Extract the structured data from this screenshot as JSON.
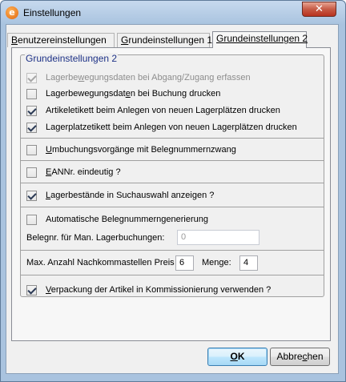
{
  "window": {
    "title": "Einstellungen",
    "close_glyph": "✕",
    "icon_letter": "e"
  },
  "tabs": [
    {
      "label_u": "B",
      "label_rest": "enutzereinstellungen",
      "active": false
    },
    {
      "label_u": "G",
      "label_rest": "rundeinstellungen 1",
      "active": false
    },
    {
      "label_u": "",
      "label_rest": "Grundeinstellungen 2",
      "active": true
    }
  ],
  "group": {
    "title": "Grundeinstellungen 2",
    "checkboxes": [
      {
        "pre": "Lagerbe",
        "u": "w",
        "post": "egungsdaten bei Abgang/Zugang erfassen",
        "checked": true,
        "disabled": true
      },
      {
        "pre": "Lagerbewegungsdat",
        "u": "e",
        "post": "n bei Buchung drucken",
        "checked": false,
        "disabled": false
      },
      {
        "pre": "Artikeletikett beim Anlegen von neuen Lagerplätzen drucken",
        "u": "",
        "post": "",
        "checked": true,
        "disabled": false
      },
      {
        "pre": "Lagerplatzetikett beim Anlegen von neuen Lagerplätzen drucken",
        "u": "",
        "post": "",
        "checked": true,
        "disabled": false
      },
      {
        "pre": "",
        "u": "U",
        "post": "mbuchungsvorgänge mit Belegnummernzwang",
        "checked": false,
        "disabled": false
      },
      {
        "pre": "",
        "u": "E",
        "post": "ANNr. eindeutig ?",
        "checked": false,
        "disabled": false
      },
      {
        "pre": "",
        "u": "L",
        "post": "agerbestände in Suchauswahl anzeigen ?",
        "checked": true,
        "disabled": false
      },
      {
        "pre": "Automatische Belegnummerngenerierung",
        "u": "",
        "post": "",
        "checked": false,
        "disabled": false
      }
    ],
    "belegnr_label": "Belegnr. für Man. Lagerbuchungen:",
    "belegnr_value": "0",
    "nachkomma_label": "Max. Anzahl Nachkommastellen Preis",
    "nachkomma_preis_value": "6",
    "menge_label": "Menge:",
    "menge_value": "4",
    "verpackung": {
      "pre": "",
      "u": "V",
      "post": "erpackung der Artikel in Kommissionierung verwenden ?",
      "checked": true,
      "disabled": false
    }
  },
  "buttons": {
    "ok": {
      "u": "O",
      "rest": "K"
    },
    "cancel": {
      "pre": "Abbre",
      "u": "c",
      "post": "hen"
    }
  }
}
